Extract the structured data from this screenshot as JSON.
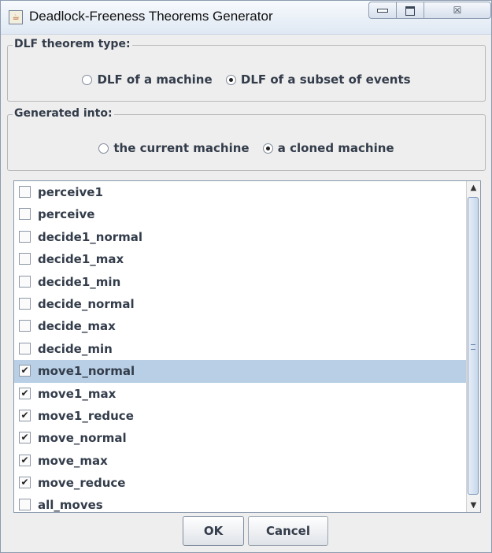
{
  "window": {
    "title": "Deadlock-Freeness Theorems Generator",
    "icon": "java-cup-icon",
    "controls": {
      "minimize": "minimize-icon",
      "maximize": "maximize-icon",
      "close": "close-icon",
      "close_glyph": "☒"
    }
  },
  "theorem_type": {
    "label": "DLF theorem type:",
    "options": [
      {
        "label": "DLF of a machine",
        "selected": false
      },
      {
        "label": "DLF of a subset of events",
        "selected": true
      }
    ]
  },
  "generated_into": {
    "label": "Generated into:",
    "options": [
      {
        "label": "the current machine",
        "selected": false
      },
      {
        "label": "a cloned machine",
        "selected": true
      }
    ]
  },
  "events": [
    {
      "label": "perceive1",
      "checked": false
    },
    {
      "label": "perceive",
      "checked": false
    },
    {
      "label": "decide1_normal",
      "checked": false
    },
    {
      "label": "decide1_max",
      "checked": false
    },
    {
      "label": "decide1_min",
      "checked": false
    },
    {
      "label": "decide_normal",
      "checked": false
    },
    {
      "label": "decide_max",
      "checked": false
    },
    {
      "label": "decide_min",
      "checked": false
    },
    {
      "label": "move1_normal",
      "checked": true,
      "selected": true
    },
    {
      "label": "move1_max",
      "checked": true
    },
    {
      "label": "move1_reduce",
      "checked": true
    },
    {
      "label": "move_normal",
      "checked": true
    },
    {
      "label": "move_max",
      "checked": true
    },
    {
      "label": "move_reduce",
      "checked": true
    },
    {
      "label": "all_moves",
      "checked": false
    }
  ],
  "check_glyph": "✔",
  "scroll": {
    "up_glyph": "▲",
    "down_glyph": "▼"
  },
  "buttons": {
    "ok": "OK",
    "cancel": "Cancel"
  },
  "colors": {
    "selection": "#b8cfe5",
    "text": "#333c4a"
  }
}
